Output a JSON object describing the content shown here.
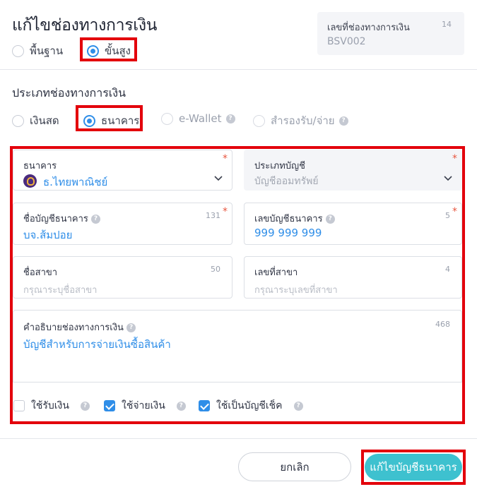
{
  "header": {
    "title": "แก้ไขช่องทางการเงิน",
    "modes": [
      {
        "label": "พื้นฐาน",
        "checked": false
      },
      {
        "label": "ขั้นสูง",
        "checked": true
      }
    ],
    "code": {
      "label": "เลขที่ช่องทางการเงิน",
      "count": "14",
      "value": "BSV002"
    }
  },
  "channel_type": {
    "title": "ประเภทช่องทางการเงิน",
    "options": [
      {
        "label": "เงินสด",
        "checked": false
      },
      {
        "label": "ธนาคาร",
        "checked": true
      },
      {
        "label": "e-Wallet",
        "checked": false,
        "disabled": true
      },
      {
        "label": "สำรองรับ/จ่าย",
        "checked": false,
        "disabled": true
      }
    ]
  },
  "form": {
    "bank": {
      "label": "ธนาคาร",
      "value": "ธ.ไทยพาณิชย์",
      "required": "*"
    },
    "account_type": {
      "label": "ประเภทบัญชี",
      "value": "บัญชีออมทรัพย์",
      "required": "*"
    },
    "account_name": {
      "label": "ชื่อบัญชีธนาคาร",
      "count": "131",
      "value": "บจ.ส้มปอย",
      "required": "*"
    },
    "account_number": {
      "label": "เลขบัญชีธนาคาร",
      "count": "5",
      "value": "999 999 999",
      "required": "*"
    },
    "branch_name": {
      "label": "ชื่อสาขา",
      "count": "50",
      "placeholder": "กรุณาระบุชื่อสาขา"
    },
    "branch_number": {
      "label": "เลขที่สาขา",
      "count": "4",
      "placeholder": "กรุณาระบุเลขที่สาขา"
    },
    "description": {
      "label": "คำอธิบายช่องทางการเงิน",
      "count": "468",
      "value": "บัญชีสำหรับการจ่ายเงินซื้อสินค้า"
    },
    "options": [
      {
        "label": "ใช้รับเงิน",
        "checked": false
      },
      {
        "label": "ใช้จ่ายเงิน",
        "checked": true
      },
      {
        "label": "ใช้เป็นบัญชีเช็ค",
        "checked": true
      }
    ]
  },
  "footer": {
    "cancel_label": "ยกเลิก",
    "save_label": "แก้ไขบัญชีธนาคาร"
  },
  "colors": {
    "accent": "#2f8ee8",
    "save_button": "#3ec1cf",
    "highlight": "#e3000b",
    "required": "#e8563f"
  }
}
